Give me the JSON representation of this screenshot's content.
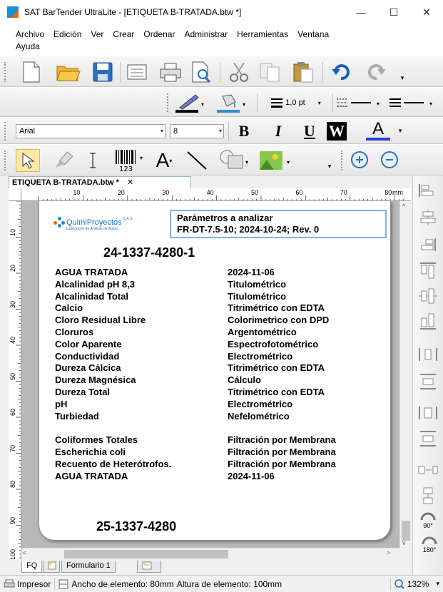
{
  "window": {
    "title": "SAT BarTender UltraLite  - [ETIQUETA B-TRATADA.btw *]",
    "minimize": "—",
    "maximize": "☐",
    "close": "✕"
  },
  "menu": {
    "items": [
      "Archivo",
      "Edición",
      "Ver",
      "Crear",
      "Ordenar",
      "Administrar",
      "Herramientas",
      "Ventana"
    ],
    "second_row": "Ayuda"
  },
  "format_toolbar": {
    "line_width": "1,0 pt"
  },
  "font_toolbar": {
    "font": "Arial",
    "size": "8",
    "bold": "B",
    "italic": "I",
    "underline": "U",
    "wide": "W",
    "color_a": "A"
  },
  "document_tab": {
    "name": "ETIQUETA B-TRATADA.btw *",
    "close": "✕"
  },
  "ruler": {
    "unit": "mm",
    "top_labels": [
      "10",
      "20",
      "30",
      "40",
      "50",
      "60",
      "70",
      "80"
    ],
    "left_labels": [
      "10",
      "20",
      "30",
      "40",
      "50",
      "60",
      "70",
      "80",
      "90",
      "100"
    ]
  },
  "label": {
    "logo_name": "QuimiProyectos",
    "logo_suffix": "S.A.S.",
    "logo_tagline": "Laboratorio de Análisis de Aguas",
    "params_title": "Parámetros a analizar",
    "params_ref": "FR-DT-7.5-10; 2024-10-24; Rev. 0",
    "code_top": "24-1337-4280-1",
    "code_bottom": "25-1337-4280",
    "rows_a": [
      [
        "AGUA TRATADA",
        "2024-11-06"
      ],
      [
        "Alcalinidad pH 8,3",
        "Titulométrico"
      ],
      [
        "Alcalinidad Total",
        "Titulométrico"
      ],
      [
        "Calcio",
        "Titrimétrico con EDTA"
      ],
      [
        "Cloro Residual Libre",
        "Colorimetrico con DPD"
      ],
      [
        "Cloruros",
        "Argentométrico"
      ],
      [
        "Color Aparente",
        "Espectrofotométrico"
      ],
      [
        "Conductividad",
        "Electrométrico"
      ],
      [
        "Dureza Cálcica",
        "Titrimétrico con EDTA"
      ],
      [
        "Dureza Magnésica",
        "Cálculo"
      ],
      [
        "Dureza Total",
        "Titrimétrico con EDTA"
      ],
      [
        "pH",
        "Electrométrico"
      ],
      [
        "Turbiedad",
        "Nefelométrico"
      ]
    ],
    "rows_b": [
      [
        "Coliformes Totales",
        "Filtración por Membrana"
      ],
      [
        "Escherichia coli",
        "Filtración por Membrana"
      ],
      [
        "Recuento de Heterótrofos.",
        "Filtración por Membrana"
      ],
      [
        "AGUA TRATADA",
        "2024-11-06"
      ]
    ]
  },
  "right_toolbar": {
    "rotate_90": "90°",
    "rotate_180": "180°"
  },
  "sheet_tabs": {
    "fq": "FQ",
    "form": "Formulario 1"
  },
  "status": {
    "printer": "Impresor",
    "width": "Ancho de elemento: 80mm",
    "height": "Altura de elemento: 100mm",
    "zoom": "132%"
  },
  "colors": {
    "accent_blue": "#1a8fd6",
    "accent_orange": "#e36c0a",
    "params_border": "#7db3e8"
  }
}
